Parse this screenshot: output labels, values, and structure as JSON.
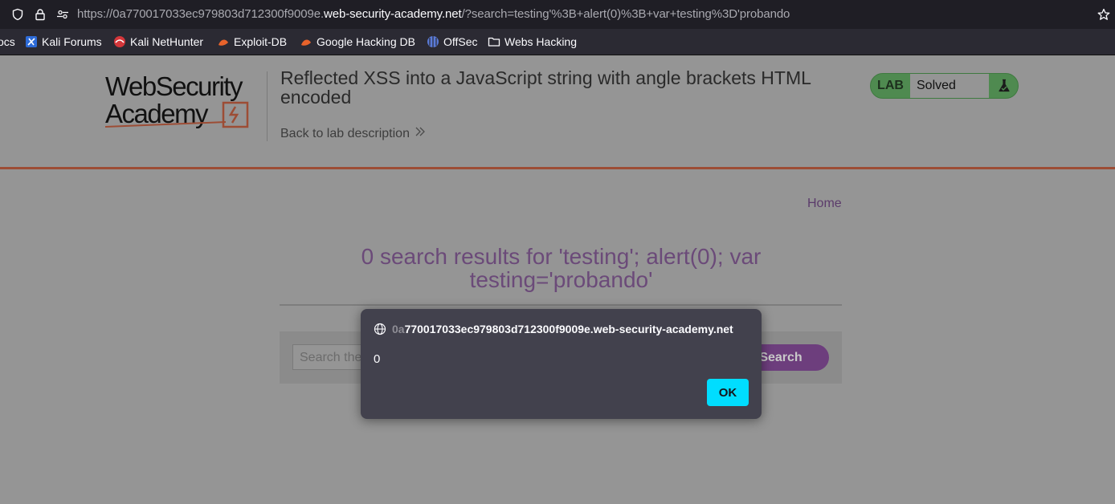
{
  "browser": {
    "url_prefix": "https://0a770017033ec979803d712300f9009e.",
    "url_domain": "web-security-academy.net",
    "url_suffix": "/?search=testing'%3B+alert(0)%3B+var+testing%3D'probando",
    "bookmarks": [
      {
        "label": "ocs",
        "icon": "docs-icon"
      },
      {
        "label": "Kali Forums",
        "icon": "kali-forums-icon"
      },
      {
        "label": "Kali NetHunter",
        "icon": "kali-nethunter-icon"
      },
      {
        "label": "Exploit-DB",
        "icon": "exploit-db-icon"
      },
      {
        "label": "Google Hacking DB",
        "icon": "ghdb-icon"
      },
      {
        "label": "OffSec",
        "icon": "offsec-icon"
      },
      {
        "label": "Webs Hacking",
        "icon": "folder-icon"
      }
    ]
  },
  "header": {
    "logo_line1": "WebSecurity",
    "logo_line2": "Academy",
    "lab_title": "Reflected XSS into a JavaScript string with angle brackets HTML encoded",
    "back_link": "Back to lab description",
    "badge_lab": "LAB",
    "badge_status": "Solved"
  },
  "main": {
    "home_link": "Home",
    "results_heading": "0 search results for 'testing'; alert(0); var testing='probando'",
    "search_placeholder": "Search the blog...",
    "search_button": "Search"
  },
  "dialog": {
    "origin_faded": "0a",
    "origin_main": "770017033ec979803d712300f9009e.web-security-academy.net",
    "message": "0",
    "ok_label": "OK"
  },
  "colors": {
    "accent_orange": "#ff6633",
    "dialog_ok": "#00ddff",
    "badge_green": "#4f8a50"
  }
}
